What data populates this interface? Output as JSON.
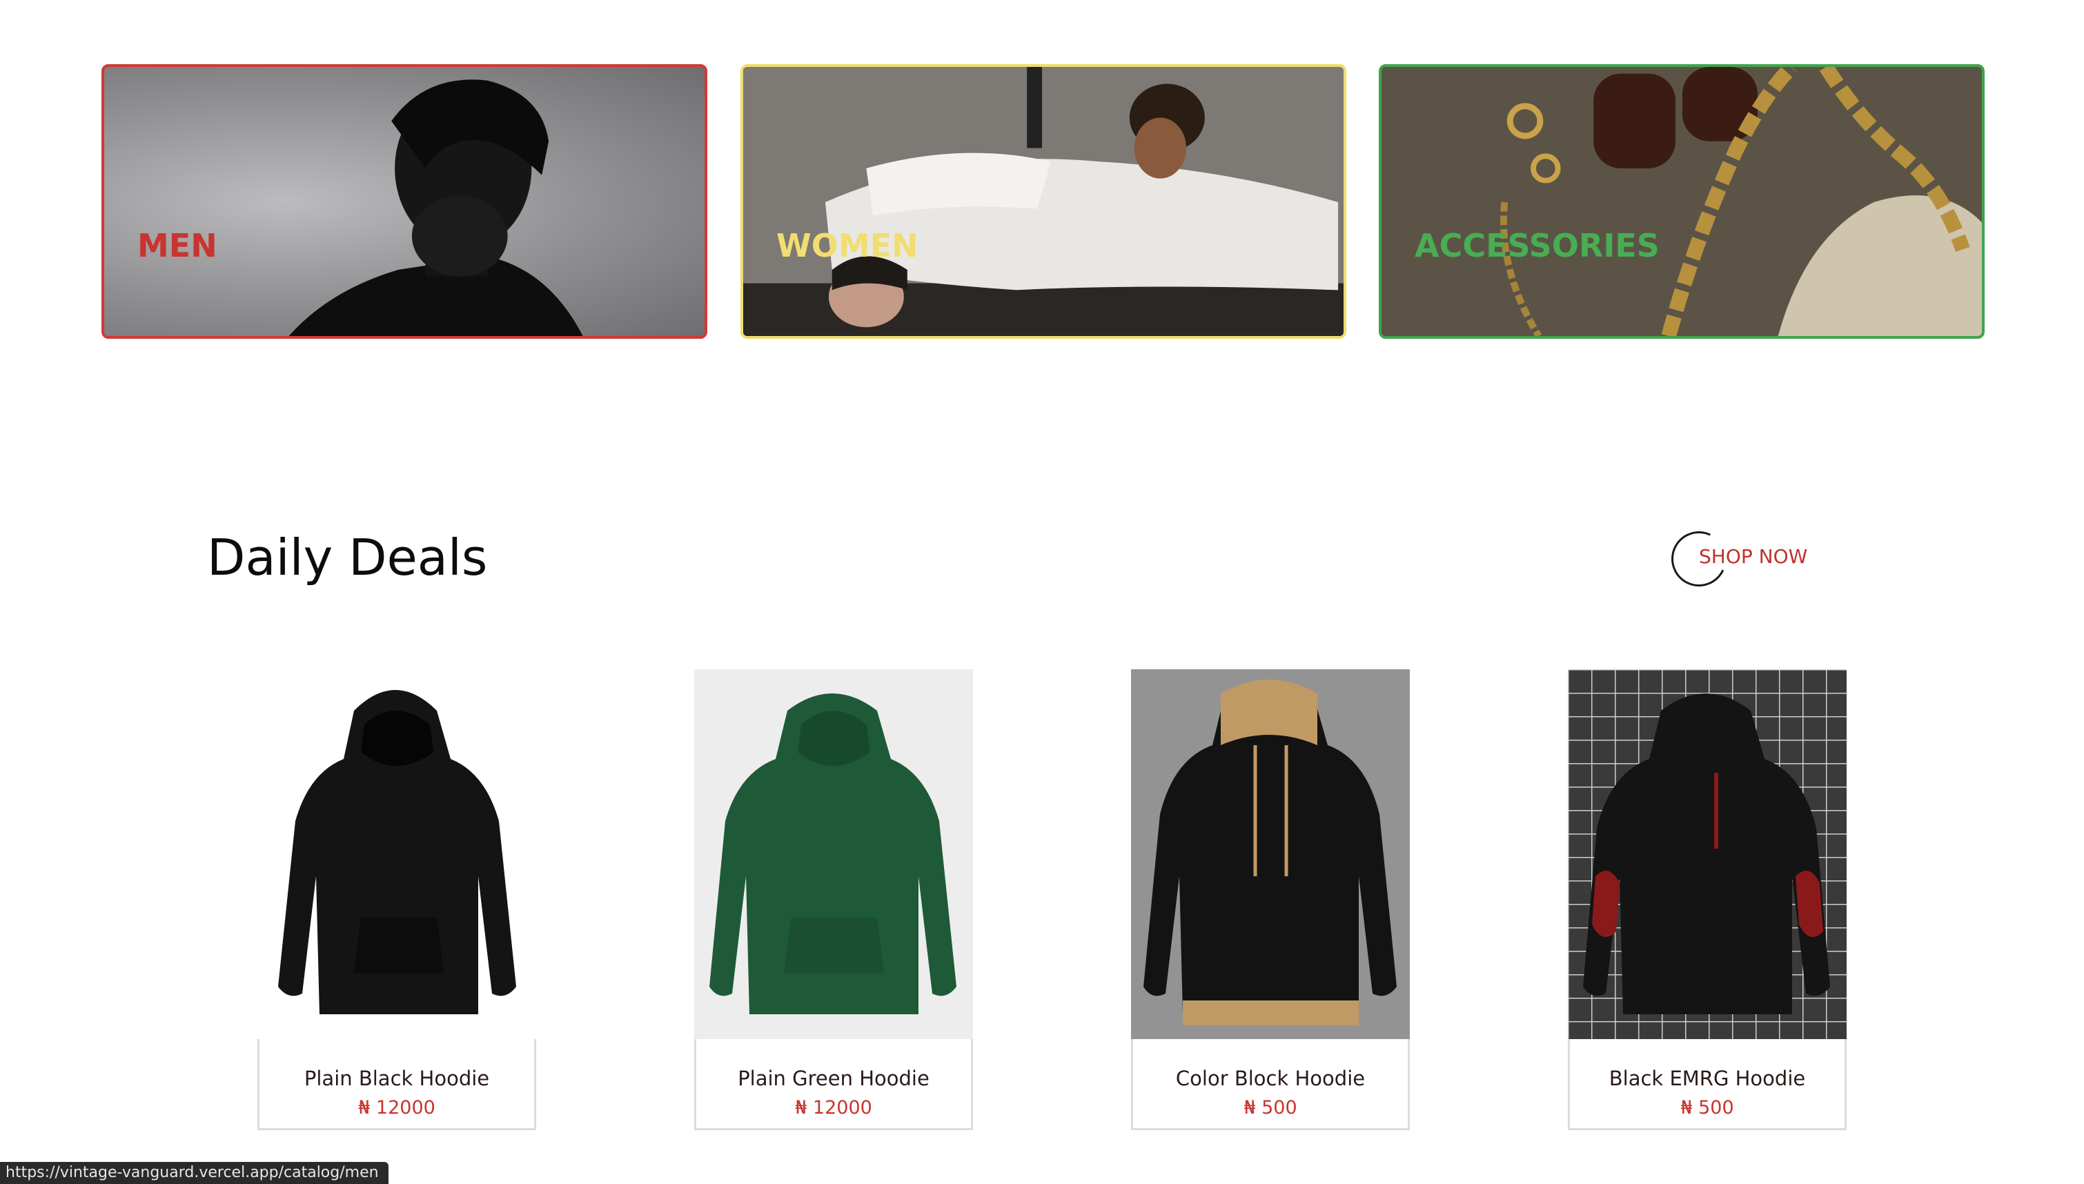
{
  "categories": [
    {
      "label": "MEN",
      "color": "#c9342f"
    },
    {
      "label": "WOMEN",
      "color": "#f2dd72"
    },
    {
      "label": "ACCESSORIES",
      "color": "#48ad53"
    }
  ],
  "deals": {
    "title": "Daily Deals",
    "shop_now": "SHOP NOW"
  },
  "products": [
    {
      "name": "Plain Black Hoodie",
      "price": "₦ 12000",
      "icon": "black-hoodie"
    },
    {
      "name": "Plain Green Hoodie",
      "price": "₦ 12000",
      "icon": "green-hoodie"
    },
    {
      "name": "Color Block Hoodie",
      "price": "₦ 500",
      "icon": "color-block-hoodie"
    },
    {
      "name": "Black EMRG Hoodie",
      "price": "₦ 500",
      "icon": "emrg-hoodie"
    }
  ],
  "status_bar": {
    "url": "https://vintage-vanguard.vercel.app/catalog/men"
  },
  "colors": {
    "accent_red": "#c9342f",
    "accent_yellow": "#f2dd72",
    "accent_green": "#48ad53"
  }
}
